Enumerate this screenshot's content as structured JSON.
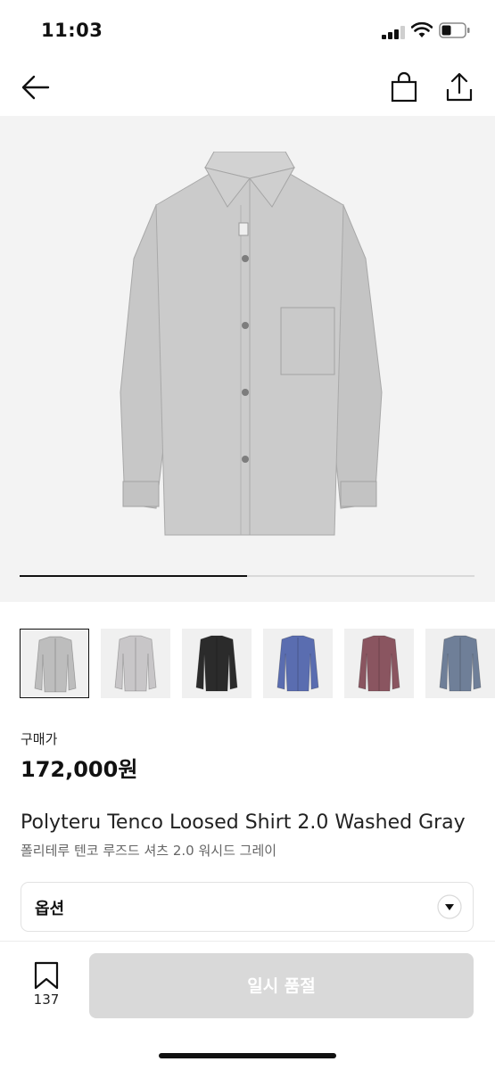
{
  "status_bar": {
    "time": "11:03"
  },
  "nav": {
    "back_icon": "arrow-left-icon",
    "bag_icon": "shopping-bag-icon",
    "share_icon": "share-icon"
  },
  "hero": {
    "image_count": 2,
    "current_index": 1,
    "progress_fraction": 0.5
  },
  "thumbnails": [
    {
      "color": "#bdbdbd",
      "active": true
    },
    {
      "color": "#c8c6c8",
      "active": false
    },
    {
      "color": "#2b2b2b",
      "active": false
    },
    {
      "color": "#5a6db0",
      "active": false
    },
    {
      "color": "#8a5560",
      "active": false
    },
    {
      "color": "#6f7f98",
      "active": false
    }
  ],
  "price": {
    "label": "구매가",
    "value": "172,000원"
  },
  "product": {
    "title_en": "Polyteru Tenco Loosed Shirt 2.0 Washed Gray",
    "title_ko": "폴리테루 텐코 루즈드 셔츠 2.0 워시드 그레이"
  },
  "option": {
    "label": "옵션",
    "icon": "chevron-down-icon"
  },
  "bottom_bar": {
    "wish_count": "137",
    "wish_icon": "bookmark-icon",
    "buy_label": "일시 품절"
  },
  "colors": {
    "accent": "#111111",
    "disabled_button": "#d9d9d9",
    "hero_bg": "#f3f3f3"
  }
}
